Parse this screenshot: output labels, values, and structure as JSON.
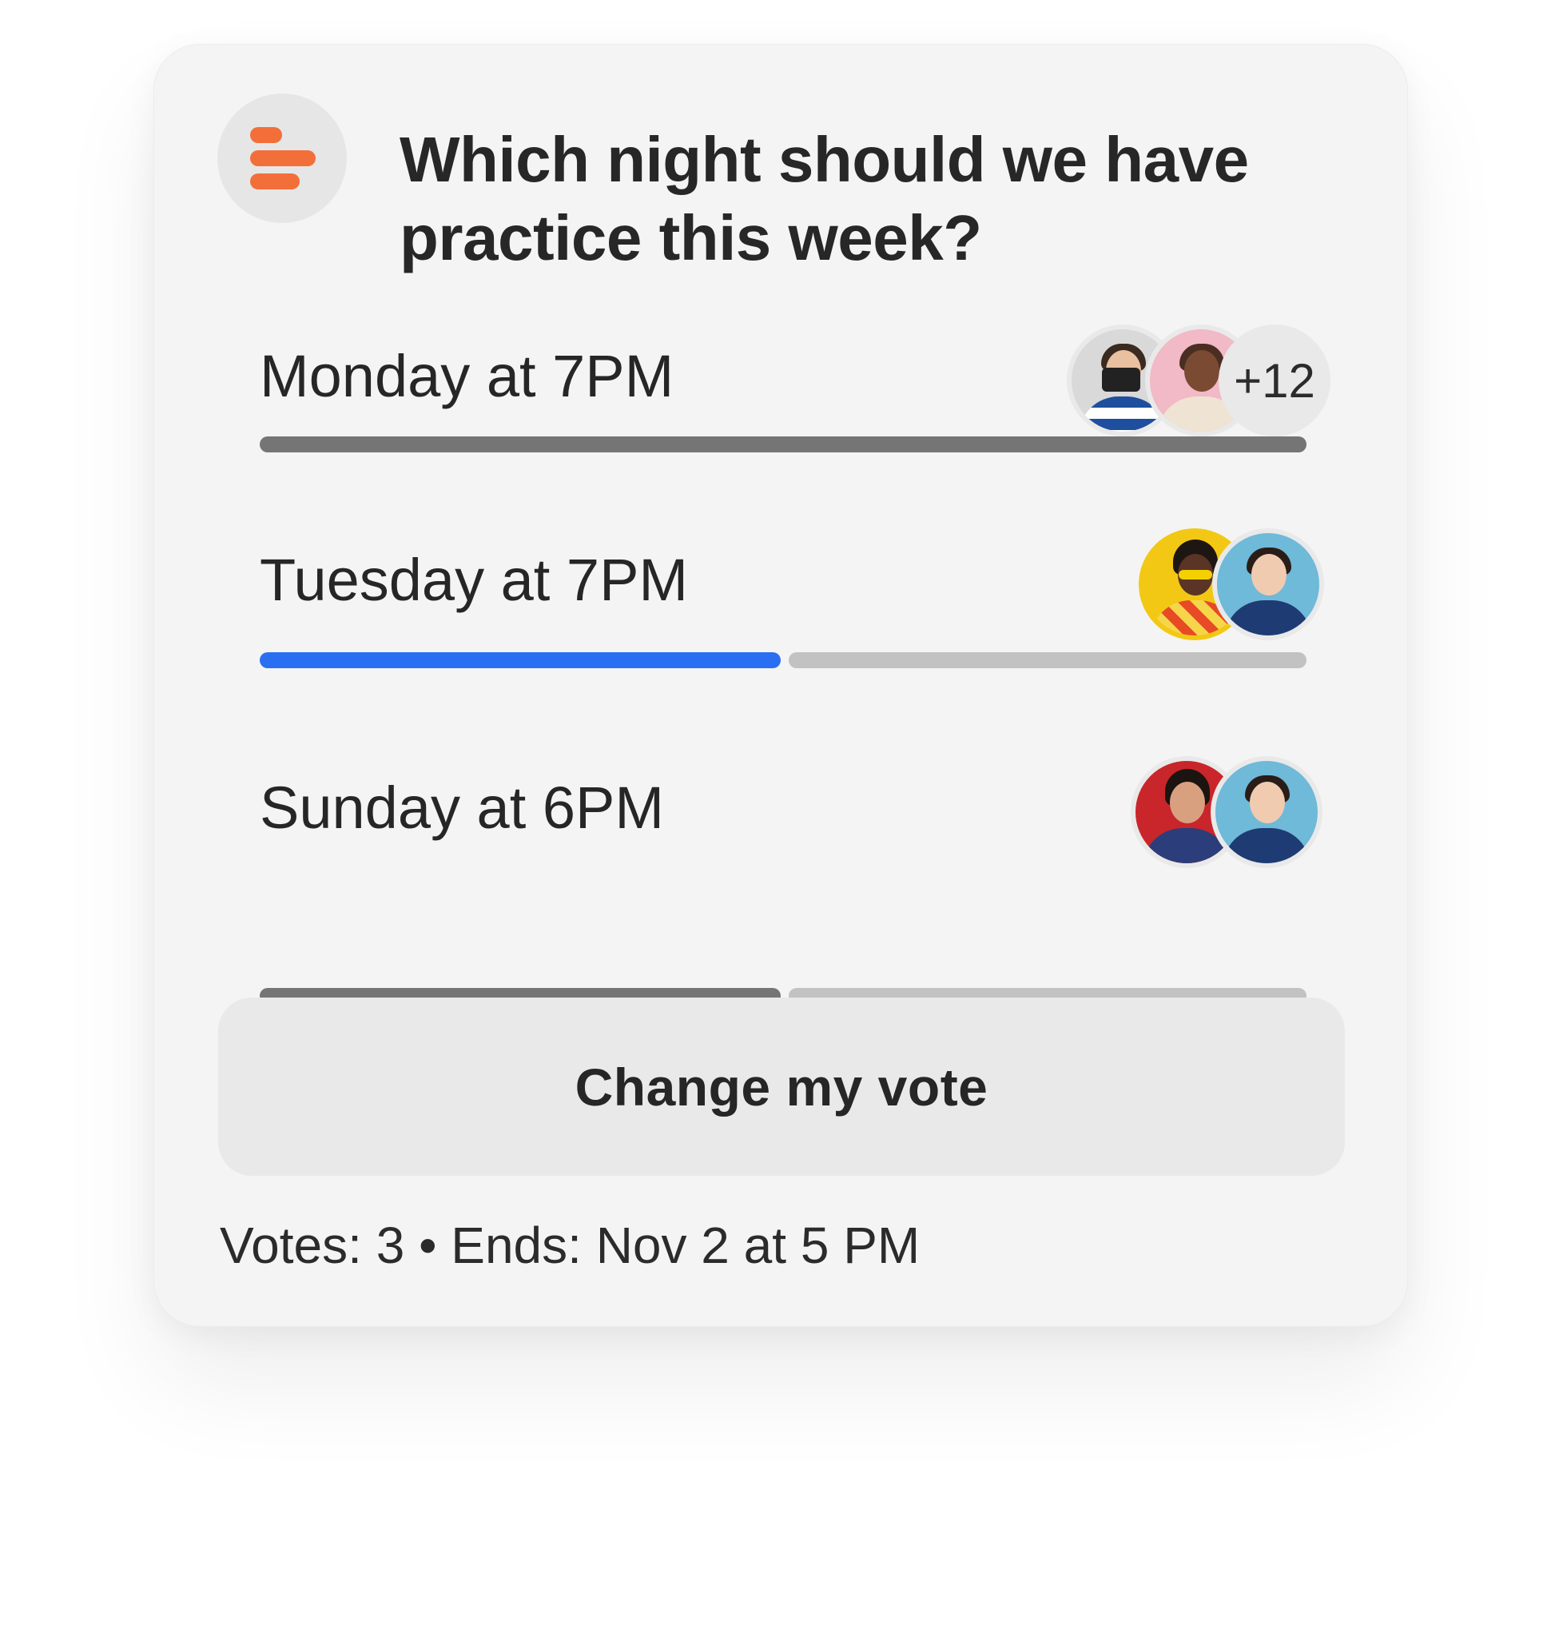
{
  "poll": {
    "question": "Which night should we have practice this week?",
    "options": [
      {
        "label": "Monday at 7PM",
        "fill_fraction": 1.0,
        "bar_color": "#757575",
        "more_voters": "+12",
        "avatars": [
          "voter-avatar-photographer",
          "voter-avatar-woman-pink"
        ]
      },
      {
        "label": "Tuesday at 7PM",
        "fill_fraction": 0.5,
        "bar_color": "#2a6ff2",
        "track_color": "#c2c2c2",
        "selected": true,
        "avatars": [
          "voter-avatar-woman-yellow",
          "voter-avatar-woman-blue"
        ]
      },
      {
        "label": "Sunday at 6PM",
        "fill_fraction": 0.5,
        "bar_color": "#757575",
        "track_color": "#c2c2c2",
        "avatars": [
          "voter-avatar-woman-red",
          "voter-avatar-woman-blue"
        ]
      }
    ],
    "change_vote_label": "Change my vote",
    "footer": "Votes: 3 • Ends: Nov 2 at 5 PM"
  },
  "colors": {
    "accent_orange": "#f36f3a",
    "selected_blue": "#2a6ff2",
    "bar_gray": "#757575",
    "track_gray": "#c2c2c2",
    "card_bg": "#f4f4f4"
  },
  "icons": {
    "logo": "poll-logo-icon"
  }
}
